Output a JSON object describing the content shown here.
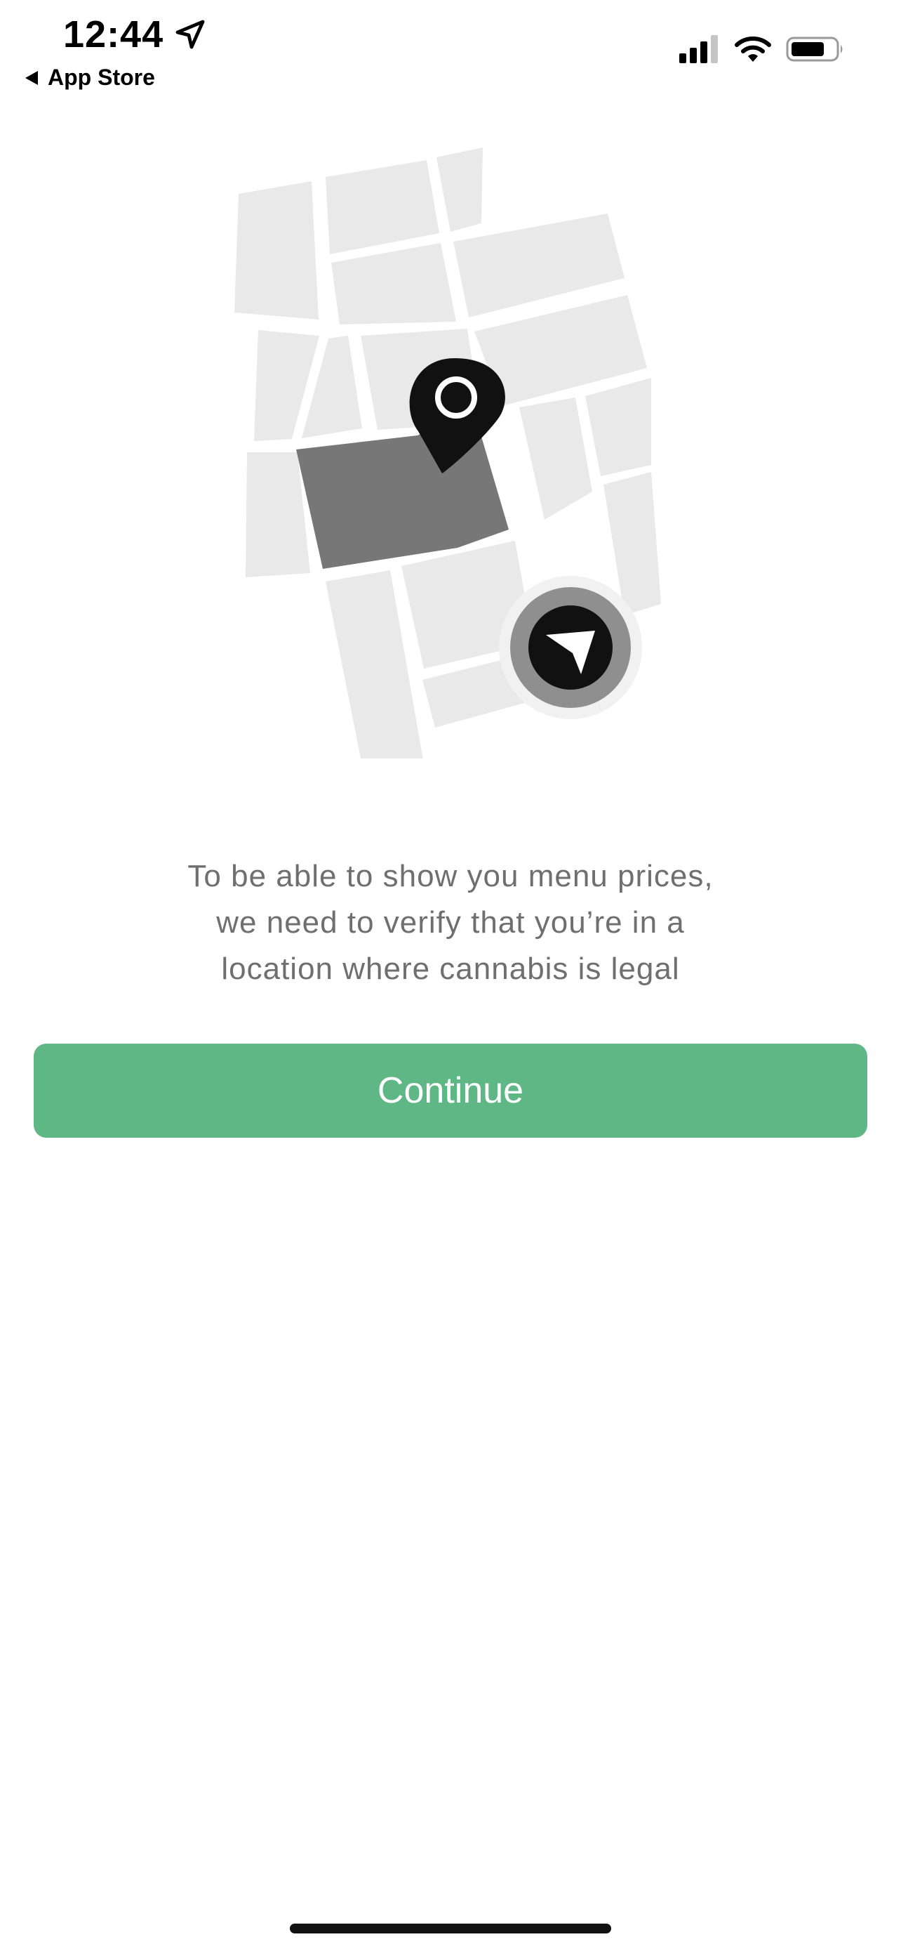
{
  "status_bar": {
    "time": "12:44",
    "back_label": "App Store",
    "icons": [
      "location-arrow-icon",
      "cellular-signal-icon",
      "wifi-icon",
      "battery-icon"
    ]
  },
  "illustration": {
    "icons": [
      "map-pin-icon",
      "current-location-icon"
    ],
    "colors": {
      "block": "#e8e9e8",
      "highlight": "#777777",
      "pin": "#111111"
    }
  },
  "message": {
    "line1": "To be able to show you menu prices,",
    "line2": "we need to verify that you’re in a",
    "line3": "location where cannabis is legal"
  },
  "continue_button": {
    "label": "Continue",
    "color": "#5eb784"
  }
}
